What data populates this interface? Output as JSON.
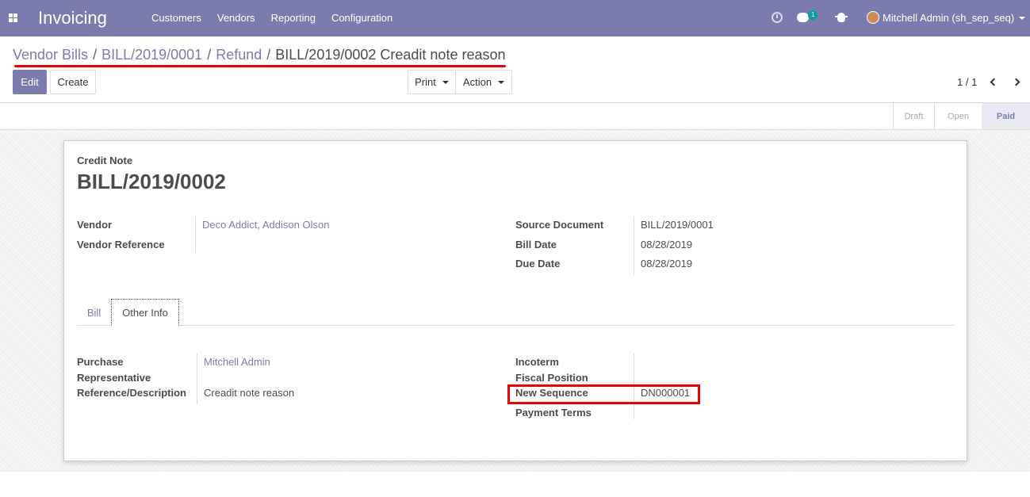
{
  "navbar": {
    "brand": "Invoicing",
    "menu": [
      "Customers",
      "Vendors",
      "Reporting",
      "Configuration"
    ],
    "chat_badge": "1",
    "user": "Mitchell Admin (sh_sep_seq)"
  },
  "breadcrumb": {
    "items": [
      "Vendor Bills",
      "BILL/2019/0001",
      "Refund"
    ],
    "current": "BILL/2019/0002 Creadit note reason"
  },
  "toolbar": {
    "edit": "Edit",
    "create": "Create",
    "print": "Print",
    "action": "Action"
  },
  "pager": {
    "value": "1 / 1"
  },
  "status": {
    "stages": [
      "Draft",
      "Open",
      "Paid"
    ],
    "active": "Paid"
  },
  "form": {
    "doc_type": "Credit Note",
    "number": "BILL/2019/0002",
    "left_fields": {
      "vendor_label": "Vendor",
      "vendor_value": "Deco Addict, Addison Olson",
      "vendor_ref_label": "Vendor Reference"
    },
    "right_fields": {
      "source_label": "Source Document",
      "source_value": "BILL/2019/0001",
      "bill_date_label": "Bill Date",
      "bill_date_value": "08/28/2019",
      "due_date_label": "Due Date",
      "due_date_value": "08/28/2019"
    },
    "tabs": [
      "Bill",
      "Other Info"
    ],
    "active_tab": "Other Info",
    "other_info": {
      "purchase_rep_label_1": "Purchase",
      "purchase_rep_label_2": "Representative",
      "purchase_rep_value": "Mitchell Admin",
      "ref_desc_label": "Reference/Description",
      "ref_desc_value": "Creadit note reason",
      "incoterm_label": "Incoterm",
      "fiscal_position_label": "Fiscal Position",
      "new_sequence_label": "New Sequence",
      "new_sequence_value": "DN000001",
      "payment_terms_label": "Payment Terms"
    }
  },
  "accent": "#7c7bad",
  "highlight": "#e00000"
}
